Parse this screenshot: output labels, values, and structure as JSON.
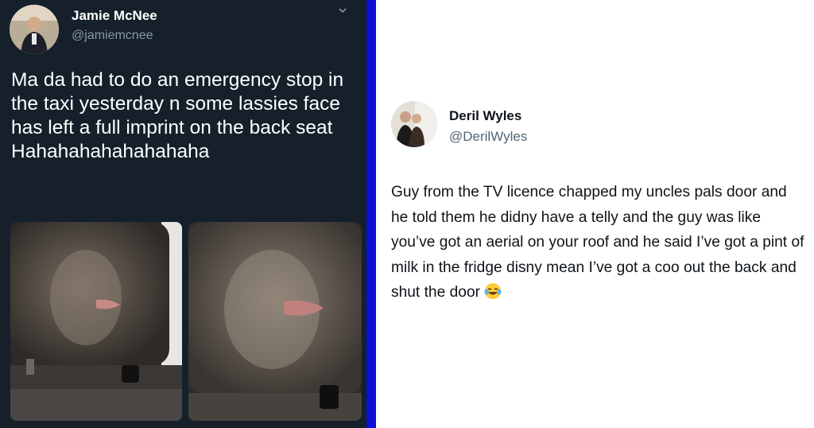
{
  "left_tweet": {
    "name": "Jamie McNee",
    "handle": "@jamiemcnee",
    "menu_icon": "chevron-down-icon",
    "text": "Ma da had to do an emergency stop in the taxi yesterday n some lassies face has left a full imprint on the back seat Hahahahahahahahaha",
    "photos": [
      "photo-1",
      "photo-2"
    ],
    "colors": {
      "background": "#15202b",
      "secondary_text": "#8b98a5"
    }
  },
  "right_tweet": {
    "name": "Deril Wyles",
    "handle": "@DerilWyles",
    "text": "Guy from the TV licence chapped my uncles pals door and he told them he didny have a telly and the guy was like you’ve got an aerial on your roof and he said I’ve got a pint of milk in the fridge disny mean I’ve got a coo out the back and shut the door",
    "emoji": "face-with-tears-of-joy-icon",
    "colors": {
      "background": "#ffffff",
      "secondary_text": "#536471"
    }
  },
  "divider_color": "#0a10d8"
}
